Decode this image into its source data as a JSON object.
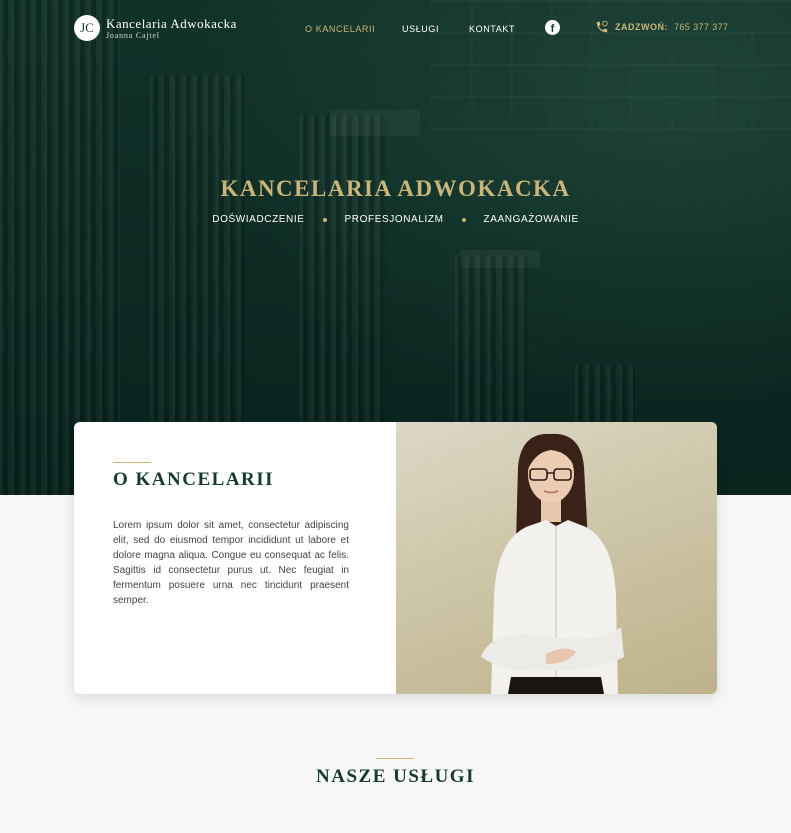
{
  "logo": {
    "mark": "JC",
    "title": "Kancelaria Adwokacka",
    "subtitle": "Joanna Cajtel"
  },
  "nav": {
    "items": [
      {
        "label": "O KANCELARII",
        "active": true
      },
      {
        "label": "USŁUGI",
        "active": false
      },
      {
        "label": "KONTAKT",
        "active": false
      }
    ],
    "facebook_icon": "facebook-icon",
    "call_label": "ZADZWOŃ:",
    "call_number": "765 377 377",
    "phone_icon": "phone-icon"
  },
  "hero": {
    "title": "KANCELARIA ADWOKACKA",
    "taglines": [
      "DOŚWIADCZENIE",
      "PROFESJONALIZM",
      "ZAANGAŻOWANIE"
    ]
  },
  "about": {
    "title": "O KANCELARII",
    "text": "Lorem ipsum dolor sit amet, consectetur adipiscing elit, sed do eiusmod tempor incididunt ut labore et dolore magna aliqua. Congue eu consequat ac felis. Sagittis id consectetur purus ut. Nec feugiat in fermentum posuere urna nec tincidunt praesent semper."
  },
  "services": {
    "title": "NASZE USŁUGI"
  },
  "colors": {
    "gold": "#c9b57a",
    "dark_green": "#163a30",
    "background": "#f7f7f7"
  }
}
